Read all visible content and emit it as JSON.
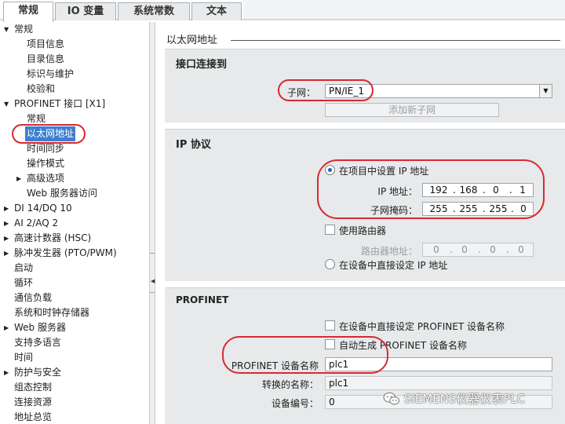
{
  "tabs": [
    {
      "label": "常规",
      "active": true
    },
    {
      "label": "IO 变量",
      "active": false
    },
    {
      "label": "系统常数",
      "active": false
    },
    {
      "label": "文本",
      "active": false
    }
  ],
  "tree": [
    {
      "label": "常规",
      "arrow": "▼"
    },
    {
      "label": "项目信息"
    },
    {
      "label": "目录信息"
    },
    {
      "label": "标识与维护"
    },
    {
      "label": "校验和"
    },
    {
      "label": "PROFINET 接口 [X1]",
      "arrow": "▼"
    },
    {
      "label": "常规"
    },
    {
      "label": "以太网地址",
      "selected": true
    },
    {
      "label": "时间同步"
    },
    {
      "label": "操作模式"
    },
    {
      "label": "高级选项",
      "arrow": "▶"
    },
    {
      "label": "Web 服务器访问"
    },
    {
      "label": "DI 14/DQ 10",
      "arrow": "▶"
    },
    {
      "label": "AI 2/AQ 2",
      "arrow": "▶"
    },
    {
      "label": "高速计数器 (HSC)",
      "arrow": "▶"
    },
    {
      "label": "脉冲发生器 (PTO/PWM)",
      "arrow": "▶"
    },
    {
      "label": "启动"
    },
    {
      "label": "循环"
    },
    {
      "label": "通信负载"
    },
    {
      "label": "系统和时钟存储器"
    },
    {
      "label": "Web 服务器",
      "arrow": "▶"
    },
    {
      "label": "支持多语言"
    },
    {
      "label": "时间"
    },
    {
      "label": "防护与安全",
      "arrow": "▶"
    },
    {
      "label": "组态控制"
    },
    {
      "label": "连接资源"
    },
    {
      "label": "地址总览"
    }
  ],
  "content": {
    "page_title": "以太网地址",
    "interface": {
      "title": "接口连接到",
      "subnet_label": "子网：",
      "subnet_value": "PN/IE_1",
      "add_subnet_button": "添加新子网"
    },
    "ip": {
      "title": "IP 协议",
      "set_in_project_label": "在项目中设置 IP 地址",
      "ip_label": "IP 地址：",
      "ip_segments": [
        "192",
        "168",
        "0",
        "1"
      ],
      "mask_label": "子网掩码：",
      "mask_segments": [
        "255",
        "255",
        "255",
        "0"
      ],
      "use_router_label": "使用路由器",
      "router_label": "路由器地址：",
      "router_segments": [
        "0",
        "0",
        "0",
        "0"
      ],
      "set_on_device_label": "在设备中直接设定 IP 地址"
    },
    "profinet": {
      "title": "PROFINET",
      "set_name_on_device_label": "在设备中直接设定 PROFINET 设备名称",
      "auto_generate_label": "自动生成 PROFINET 设备名称",
      "device_name_label": "PROFINET 设备名称",
      "device_name_value": "plc1",
      "converted_name_label": "转换的名称：",
      "converted_name_value": "plc1",
      "device_number_label": "设备编号：",
      "device_number_value": "0"
    }
  },
  "watermark": {
    "text": "SIEMENS仪器仪表PLC"
  },
  "colors": {
    "annotation": "#d62a33",
    "selection": "#3f7fd0",
    "section_bg": "#e7e9ea"
  }
}
